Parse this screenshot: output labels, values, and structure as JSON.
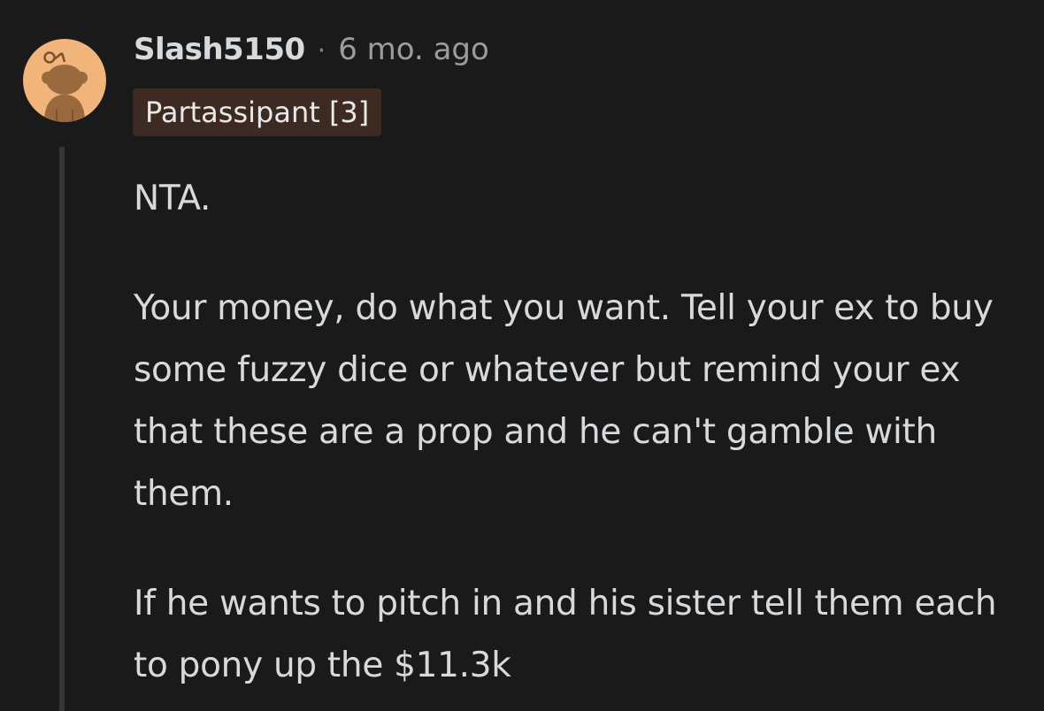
{
  "comment": {
    "author": "Slash5150",
    "separator": "·",
    "timestamp": "6 mo. ago",
    "flair": "Partassipant [3]",
    "avatar_icon": "snoo-avatar-icon",
    "colors": {
      "background": "#1a1a1b",
      "avatar_bg": "#f1b47a",
      "flair_bg": "#3d2b23",
      "text": "#d7dadc"
    },
    "paragraphs": [
      "NTA.",
      "Your money, do what you want. Tell your ex to buy some fuzzy dice or whatever but remind your ex that these are a prop and he can't gamble with them.",
      "If he wants to pitch in and his sister tell them each to pony up the $11.3k"
    ]
  }
}
